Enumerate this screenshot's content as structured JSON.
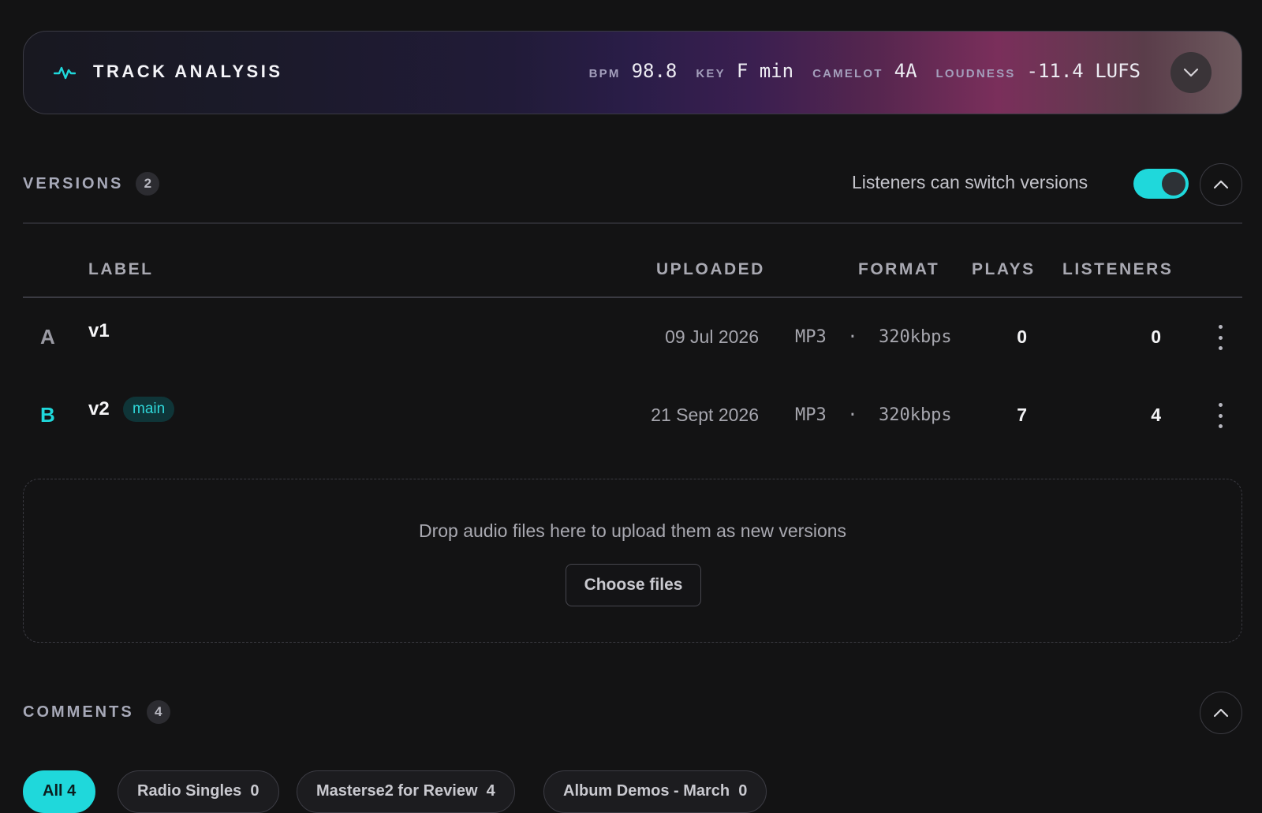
{
  "analysis": {
    "title": "TRACK ANALYSIS",
    "metrics": [
      {
        "label": "BPM",
        "value": "98.8"
      },
      {
        "label": "KEY",
        "value": "F min"
      },
      {
        "label": "CAMELOT",
        "value": "4A"
      },
      {
        "label": "LOUDNESS",
        "value": "-11.4 LUFS"
      }
    ],
    "icon": "pulse-icon",
    "toggle_icon": "chevron-down-icon"
  },
  "versions": {
    "title": "VERSIONS",
    "count": "2",
    "switch_label": "Listeners can switch versions",
    "switch_on": true,
    "collapse_icon": "chevron-up-icon",
    "columns": {
      "label": "LABEL",
      "uploaded": "UPLOADED",
      "format": "FORMAT",
      "plays": "PLAYS",
      "listeners": "LISTENERS"
    },
    "rows": [
      {
        "letter": "A",
        "label": "v1",
        "badge": "",
        "uploaded": "09 Jul 2026",
        "format": "MP3  ·  320kbps",
        "plays": "0",
        "listeners": "0"
      },
      {
        "letter": "B",
        "label": "v2",
        "badge": "main",
        "uploaded": "21 Sept 2026",
        "format": "MP3  ·  320kbps",
        "plays": "7",
        "listeners": "4"
      }
    ],
    "dropzone": {
      "text": "Drop audio files here to upload them as new versions",
      "button": "Choose files"
    }
  },
  "comments": {
    "title": "COMMENTS",
    "count": "4",
    "collapse_icon": "chevron-up-icon",
    "filters": [
      {
        "label": "All",
        "count": "4",
        "active": true
      },
      {
        "label": "Radio Singles",
        "count": "0",
        "active": false
      },
      {
        "label": "Masterse2 for Review",
        "count": "4",
        "active": false
      },
      {
        "label": "Album Demos - March",
        "count": "0",
        "active": false
      }
    ]
  },
  "colors": {
    "accent": "#1fd8db",
    "background": "#131314",
    "letter_a": "#9a9aa3",
    "letter_b": "#1fd8db"
  }
}
